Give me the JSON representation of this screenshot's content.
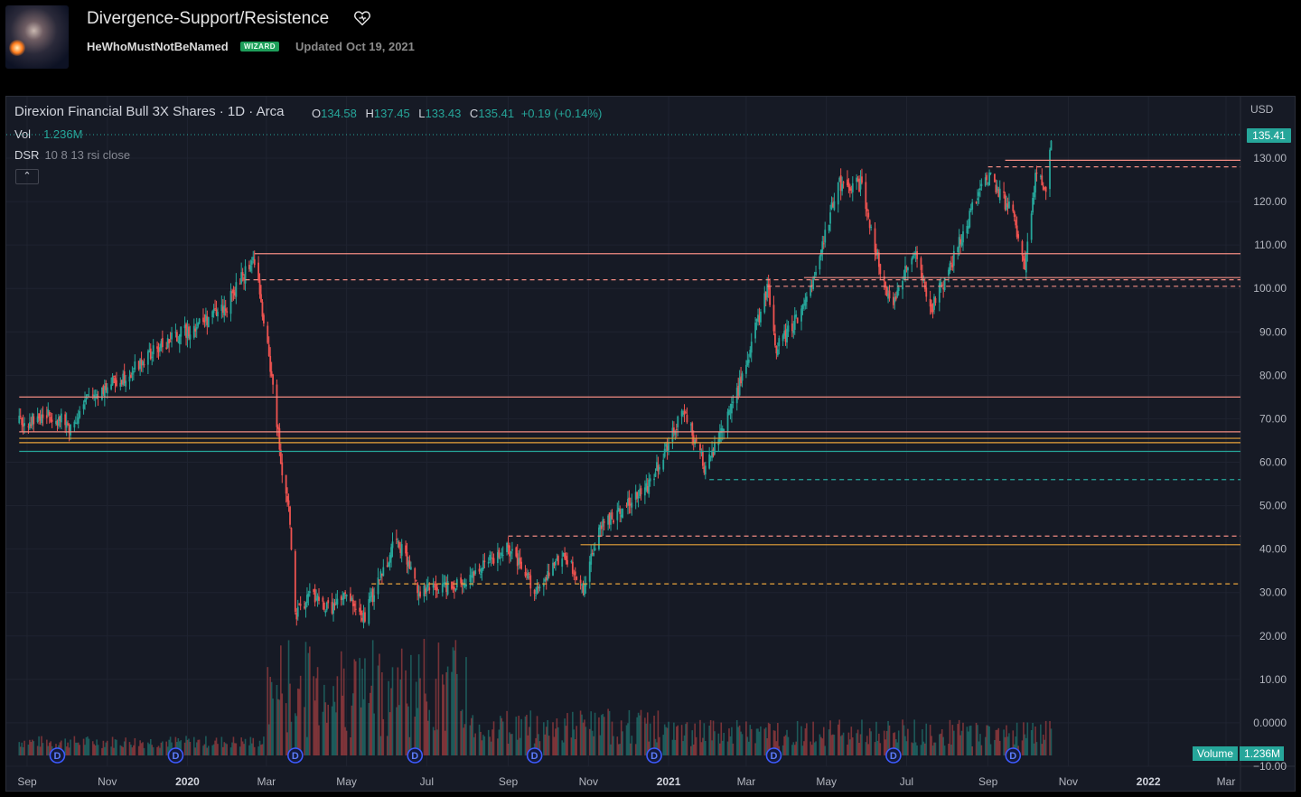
{
  "header": {
    "title": "Divergence-Support/Resistence",
    "author": "HeWhoMustNotBeNamed",
    "badge": "WIZARD",
    "updated_label": "Updated",
    "updated_date": "Oct 19, 2021"
  },
  "icons": {
    "like": "heart-icon",
    "collapse": "chevron-up-icon",
    "dividend": "dividend-marker-icon"
  },
  "colors": {
    "up": "#26a69a",
    "down": "#ef5350",
    "resistance": "#f28b82",
    "support_orange": "#e8a33a",
    "support_green": "#26a69a",
    "background": "#161a25"
  },
  "chart": {
    "symbol": "Direxion Financial Bull 3X Shares · 1D · Arca",
    "ohlc": {
      "o_label": "O",
      "o": "134.58",
      "h_label": "H",
      "h": "137.45",
      "l_label": "L",
      "l": "133.43",
      "c_label": "C",
      "c": "135.41",
      "change": "+0.19 (+0.14%)"
    },
    "volume": {
      "label": "Vol",
      "value": "1.236M",
      "tag_label": "Volume",
      "tag_value": "1.236M"
    },
    "indicator": {
      "name": "DSR",
      "params": "10 8 13 rsi close"
    },
    "currency": "USD",
    "last_price_tag": "135.41",
    "dividend_marker_label": "D"
  },
  "chart_data": {
    "type": "candlestick",
    "title": "Direxion Financial Bull 3X Shares · 1D · Arca",
    "x_tick_labels": [
      "Sep",
      "Nov",
      "2020",
      "Mar",
      "May",
      "Jul",
      "Sep",
      "Nov",
      "2021",
      "Mar",
      "May",
      "Jul",
      "Sep",
      "Nov",
      "2022",
      "Mar"
    ],
    "x_tick_bold": [
      "2020",
      "2021",
      "2022"
    ],
    "y_tick_labels": [
      "130.00",
      "120.00",
      "110.00",
      "100.00",
      "90.00",
      "80.00",
      "70.00",
      "60.00",
      "50.00",
      "40.00",
      "30.00",
      "20.00",
      "10.00",
      "0.0000",
      "−10.00"
    ],
    "y_tick_values": [
      130,
      120,
      110,
      100,
      90,
      80,
      70,
      60,
      50,
      40,
      30,
      20,
      10,
      0,
      -10
    ],
    "ylim": [
      -10,
      138
    ],
    "grid": true,
    "price_path": [
      [
        "2019-08-26",
        69
      ],
      [
        "2019-09-20",
        71
      ],
      [
        "2019-10-04",
        68
      ],
      [
        "2019-10-18",
        75
      ],
      [
        "2019-11-15",
        80
      ],
      [
        "2019-12-13",
        87
      ],
      [
        "2020-01-10",
        92
      ],
      [
        "2020-01-31",
        96
      ],
      [
        "2020-02-14",
        104
      ],
      [
        "2020-02-21",
        107
      ],
      [
        "2020-02-28",
        92
      ],
      [
        "2020-03-06",
        78
      ],
      [
        "2020-03-12",
        60
      ],
      [
        "2020-03-18",
        50
      ],
      [
        "2020-03-23",
        24
      ],
      [
        "2020-04-03",
        30
      ],
      [
        "2020-04-17",
        26
      ],
      [
        "2020-05-01",
        29
      ],
      [
        "2020-05-14",
        24
      ],
      [
        "2020-06-08",
        43
      ],
      [
        "2020-06-26",
        30
      ],
      [
        "2020-07-31",
        33
      ],
      [
        "2020-08-31",
        40
      ],
      [
        "2020-09-24",
        30
      ],
      [
        "2020-10-12",
        39
      ],
      [
        "2020-10-28",
        31
      ],
      [
        "2020-11-09",
        45
      ],
      [
        "2020-12-15",
        54
      ],
      [
        "2021-01-13",
        72
      ],
      [
        "2021-01-29",
        58
      ],
      [
        "2021-02-22",
        76
      ],
      [
        "2021-03-17",
        100
      ],
      [
        "2021-03-24",
        86
      ],
      [
        "2021-04-15",
        96
      ],
      [
        "2021-05-10",
        124
      ],
      [
        "2021-05-27",
        124
      ],
      [
        "2021-06-18",
        96
      ],
      [
        "2021-07-07",
        108
      ],
      [
        "2021-07-19",
        95
      ],
      [
        "2021-08-05",
        106
      ],
      [
        "2021-08-30",
        127
      ],
      [
        "2021-09-20",
        117
      ],
      [
        "2021-09-29",
        104
      ],
      [
        "2021-10-08",
        128
      ],
      [
        "2021-10-15",
        121
      ],
      [
        "2021-10-19",
        135.41
      ]
    ],
    "volume_series": {
      "name": "Volume",
      "latest": "1.236M"
    },
    "levels": [
      {
        "price": 108,
        "style": "solid",
        "color": "#f28b82",
        "from": "2020-02-21"
      },
      {
        "price": 102,
        "style": "dashed",
        "color": "#f28b82",
        "from": "2020-02-14"
      },
      {
        "price": 75,
        "style": "solid",
        "color": "#f28b82",
        "from": "2019-08-26"
      },
      {
        "price": 67,
        "style": "solid",
        "color": "#f28b82",
        "from": "2019-08-26"
      },
      {
        "price": 65.5,
        "style": "solid",
        "color": "#e8a33a",
        "from": "2019-08-26"
      },
      {
        "price": 64.5,
        "style": "solid",
        "color": "#e8a33a",
        "from": "2019-08-26"
      },
      {
        "price": 62.5,
        "style": "solid",
        "color": "#26a69a",
        "from": "2019-08-26"
      },
      {
        "price": 56,
        "style": "dashed",
        "color": "#26a69a",
        "from": "2021-02-01"
      },
      {
        "price": 43,
        "style": "dashed",
        "color": "#f28b82",
        "from": "2020-09-01"
      },
      {
        "price": 41,
        "style": "solid",
        "color": "#e8a33a",
        "from": "2020-10-26"
      },
      {
        "price": 32,
        "style": "dashed",
        "color": "#e8a33a",
        "from": "2020-05-20"
      },
      {
        "price": 129.5,
        "style": "solid",
        "color": "#f28b82",
        "from": "2021-09-14"
      },
      {
        "price": 128,
        "style": "dashed",
        "color": "#f28b82",
        "from": "2021-09-01"
      },
      {
        "price": 102.5,
        "style": "solid",
        "color": "#f28b82",
        "from": "2021-04-14"
      },
      {
        "price": 100.5,
        "style": "dashed",
        "color": "#f28b82",
        "from": "2021-03-17"
      }
    ],
    "dividend_marker_dates": [
      "2019-09-24",
      "2019-12-23",
      "2020-03-23",
      "2020-06-22",
      "2020-09-21",
      "2020-12-21",
      "2021-03-22",
      "2021-06-21",
      "2021-09-20"
    ],
    "last_price": 135.41
  }
}
